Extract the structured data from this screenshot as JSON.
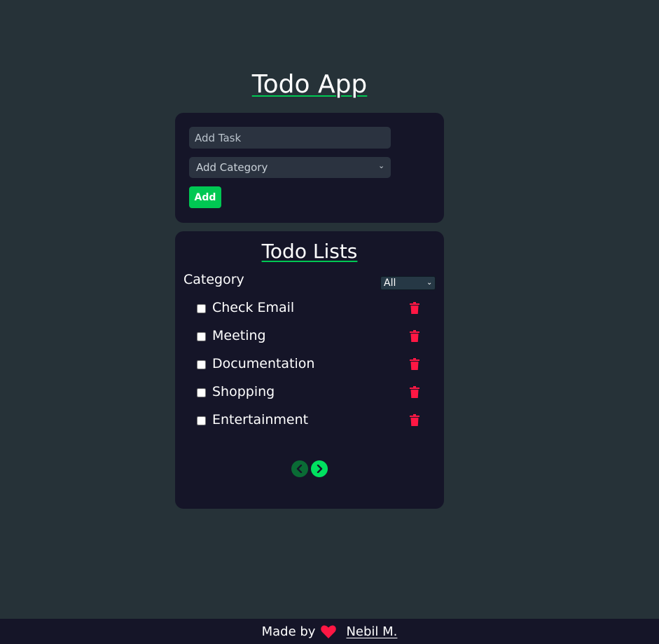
{
  "header": {
    "title": "Todo App"
  },
  "form": {
    "task_placeholder": "Add Task",
    "category_placeholder": "Add Category",
    "add_label": "Add"
  },
  "list": {
    "title": "Todo Lists",
    "filter_label": "Category",
    "filter_value": "All",
    "items": [
      {
        "text": "Check Email",
        "done": false
      },
      {
        "text": "Meeting",
        "done": false
      },
      {
        "text": "Documentation",
        "done": false
      },
      {
        "text": "Shopping",
        "done": false
      },
      {
        "text": "Entertainment",
        "done": false
      }
    ]
  },
  "footer": {
    "made_by": "Made by",
    "author": "Nebil M."
  },
  "colors": {
    "background": "#263238",
    "card": "#151528",
    "accent": "#00c853",
    "delete": "#ff1744"
  },
  "icons": [
    "trash-icon",
    "chevron-left-icon",
    "chevron-right-icon",
    "heart-icon",
    "chevron-down-icon"
  ]
}
